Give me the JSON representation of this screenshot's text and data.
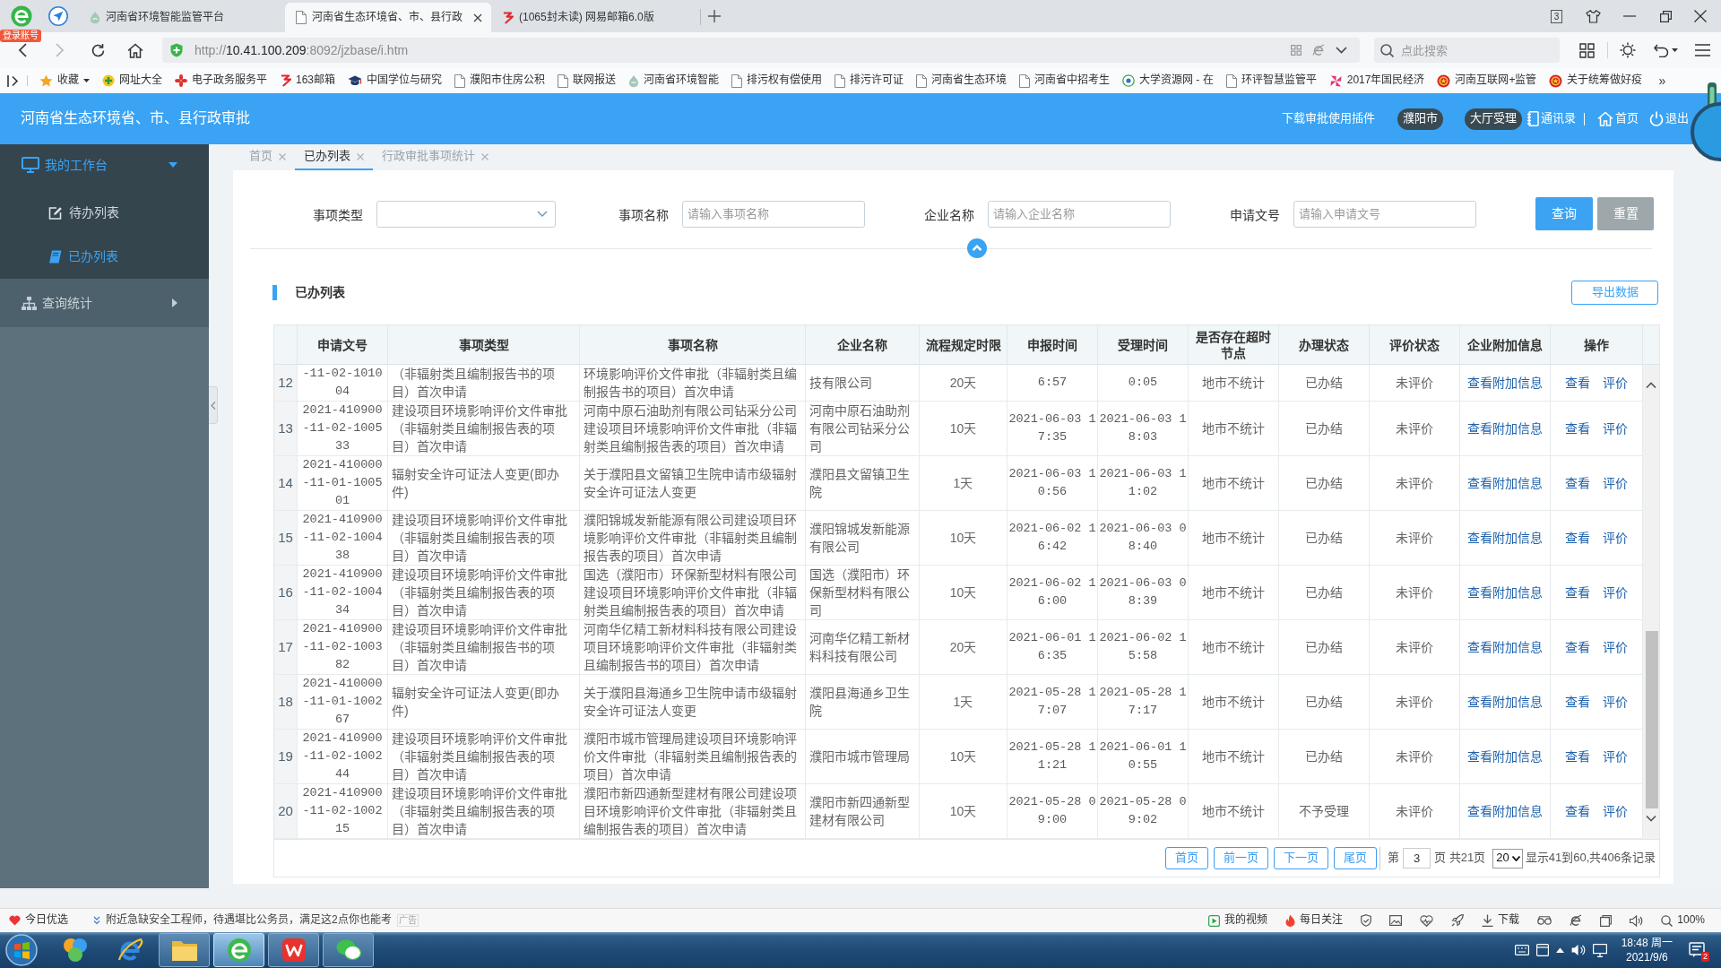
{
  "browser": {
    "login_badge": "登录账号",
    "tabs": [
      {
        "title": "河南省环境智能监管平台",
        "selected": false
      },
      {
        "title": "河南省生态环境省、市、县行政",
        "selected": true
      },
      {
        "title": "(1065封未读) 网易邮箱6.0版",
        "selected": false
      }
    ],
    "tab_count": "3",
    "url": {
      "scheme": "http://",
      "host": "10.41.100.209",
      "path": ":8092/jzbase/i.htm"
    },
    "search": {
      "placeholder": "点此搜索"
    },
    "bookmarks": [
      {
        "label": "收藏"
      },
      {
        "label": "网址大全"
      },
      {
        "label": "电子政务服务平"
      },
      {
        "label": "163邮箱"
      },
      {
        "label": "中国学位与研究"
      },
      {
        "label": "濮阳市住房公积"
      },
      {
        "label": "联网报送"
      },
      {
        "label": "河南省环境智能"
      },
      {
        "label": "排污权有偿使用"
      },
      {
        "label": "排污许可证"
      },
      {
        "label": "河南省生态环境"
      },
      {
        "label": "河南省中招考生"
      },
      {
        "label": "大学资源网 - 在"
      },
      {
        "label": "环评智慧监管平"
      },
      {
        "label": "2017年国民经济"
      },
      {
        "label": "河南互联网+监管"
      },
      {
        "label": "关于统筹做好疫"
      }
    ],
    "bookmarks_more": "»"
  },
  "header": {
    "title": "河南省生态环境省、市、县行政审批",
    "links": [
      {
        "label": "下载审批使用插件",
        "kind": "link"
      },
      {
        "label": "濮阳市",
        "kind": "pill"
      },
      {
        "label": "大厅受理",
        "kind": "pill"
      },
      {
        "label": "通讯录",
        "kind": "link"
      },
      {
        "label": "首页",
        "kind": "link"
      },
      {
        "label": "退出",
        "kind": "link"
      }
    ]
  },
  "sidebar": {
    "items": [
      {
        "label": "我的工作台",
        "expanded": true,
        "children": [
          {
            "label": "待办列表",
            "selected": false
          },
          {
            "label": "已办列表",
            "selected": true
          }
        ]
      },
      {
        "label": "查询统计",
        "expanded": false
      }
    ]
  },
  "page_tabs": [
    {
      "label": "首页",
      "selected": false
    },
    {
      "label": "已办列表",
      "selected": true
    },
    {
      "label": "行政审批事项统计",
      "selected": false
    }
  ],
  "filters": {
    "fields": [
      {
        "label": "事项类型",
        "kind": "select"
      },
      {
        "label": "事项名称",
        "kind": "input",
        "placeholder": "请输入事项名称"
      },
      {
        "label": "企业名称",
        "kind": "input",
        "placeholder": "请输入企业名称"
      },
      {
        "label": "申请文号",
        "kind": "input",
        "placeholder": "请输入申请文号"
      }
    ],
    "buttons": [
      {
        "label": "查询",
        "kind": "primary"
      },
      {
        "label": "重置",
        "kind": "secondary"
      }
    ]
  },
  "list": {
    "title": "已办列表",
    "export_button": "导出数据",
    "table": {
      "columns": [
        "申请文号",
        "事项类型",
        "事项名称",
        "企业名称",
        "流程规定时限",
        "申报时间",
        "受理时间",
        "是否存在超时节点",
        "办理状态",
        "评价状态",
        "企业附加信息",
        "操作"
      ],
      "rows": [
        {
          "no": "12",
          "application_no": "-11-02-101004",
          "item_type": "（非辐射类且编制报告书的项目）首次申请",
          "item_name": "环境影响评价文件审批（非辐射类且编制报告书的项目）首次申请",
          "company": "技有限公司",
          "time_limit": "20天",
          "submitted": "6:57",
          "accepted": "0:05",
          "overtime": "地市不统计",
          "status": "已办结",
          "rating": "未评价",
          "extra_info": "查看附加信息",
          "actions": [
            "查看",
            "评价"
          ]
        },
        {
          "no": "13",
          "application_no": "2021-410900-11-02-100533",
          "item_type": "建设项目环境影响评价文件审批（非辐射类且编制报告表的项目）首次申请",
          "item_name": "河南中原石油助剂有限公司钻采分公司建设项目环境影响评价文件审批（非辐射类且编制报告表的项目）首次申请",
          "company": "河南中原石油助剂有限公司钻采分公司",
          "time_limit": "10天",
          "submitted": "2021-06-03 17:35",
          "accepted": "2021-06-03 18:03",
          "overtime": "地市不统计",
          "status": "已办结",
          "rating": "未评价",
          "extra_info": "查看附加信息",
          "actions": [
            "查看",
            "评价"
          ]
        },
        {
          "no": "14",
          "application_no": "2021-410000-11-01-100501",
          "item_type": "辐射安全许可证法人变更(即办件)",
          "item_name": "关于濮阳县文留镇卫生院申请市级辐射安全许可证法人变更",
          "company": "濮阳县文留镇卫生院",
          "time_limit": "1天",
          "submitted": "2021-06-03 10:56",
          "accepted": "2021-06-03 11:02",
          "overtime": "地市不统计",
          "status": "已办结",
          "rating": "未评价",
          "extra_info": "查看附加信息",
          "actions": [
            "查看",
            "评价"
          ]
        },
        {
          "no": "15",
          "application_no": "2021-410900-11-02-100438",
          "item_type": "建设项目环境影响评价文件审批（非辐射类且编制报告表的项目）首次申请",
          "item_name": "濮阳锦城发新能源有限公司建设项目环境影响评价文件审批（非辐射类且编制报告表的项目）首次申请",
          "company": "濮阳锦城发新能源有限公司",
          "time_limit": "10天",
          "submitted": "2021-06-02 16:42",
          "accepted": "2021-06-03 08:40",
          "overtime": "地市不统计",
          "status": "已办结",
          "rating": "未评价",
          "extra_info": "查看附加信息",
          "actions": [
            "查看",
            "评价"
          ]
        },
        {
          "no": "16",
          "application_no": "2021-410900-11-02-100434",
          "item_type": "建设项目环境影响评价文件审批（非辐射类且编制报告表的项目）首次申请",
          "item_name": "国选（濮阳市）环保新型材料有限公司建设项目环境影响评价文件审批（非辐射类且编制报告表的项目）首次申请",
          "company": "国选（濮阳市）环保新型材料有限公司",
          "time_limit": "10天",
          "submitted": "2021-06-02 16:00",
          "accepted": "2021-06-03 08:39",
          "overtime": "地市不统计",
          "status": "已办结",
          "rating": "未评价",
          "extra_info": "查看附加信息",
          "actions": [
            "查看",
            "评价"
          ]
        },
        {
          "no": "17",
          "application_no": "2021-410900-11-02-100382",
          "item_type": "建设项目环境影响评价文件审批（非辐射类且编制报告书的项目）首次申请",
          "item_name": "河南华亿精工新材料科技有限公司建设项目环境影响评价文件审批（非辐射类且编制报告书的项目）首次申请",
          "company": "河南华亿精工新材料科技有限公司",
          "time_limit": "20天",
          "submitted": "2021-06-01 16:35",
          "accepted": "2021-06-02 15:58",
          "overtime": "地市不统计",
          "status": "已办结",
          "rating": "未评价",
          "extra_info": "查看附加信息",
          "actions": [
            "查看",
            "评价"
          ]
        },
        {
          "no": "18",
          "application_no": "2021-410000-11-01-100267",
          "item_type": "辐射安全许可证法人变更(即办件)",
          "item_name": "关于濮阳县海通乡卫生院申请市级辐射安全许可证法人变更",
          "company": "濮阳县海通乡卫生院",
          "time_limit": "1天",
          "submitted": "2021-05-28 17:07",
          "accepted": "2021-05-28 17:17",
          "overtime": "地市不统计",
          "status": "已办结",
          "rating": "未评价",
          "extra_info": "查看附加信息",
          "actions": [
            "查看",
            "评价"
          ]
        },
        {
          "no": "19",
          "application_no": "2021-410900-11-02-100244",
          "item_type": "建设项目环境影响评价文件审批（非辐射类且编制报告表的项目）首次申请",
          "item_name": "濮阳市城市管理局建设项目环境影响评价文件审批（非辐射类且编制报告表的项目）首次申请",
          "company": "濮阳市城市管理局",
          "time_limit": "10天",
          "submitted": "2021-05-28 11:21",
          "accepted": "2021-06-01 10:55",
          "overtime": "地市不统计",
          "status": "已办结",
          "rating": "未评价",
          "extra_info": "查看附加信息",
          "actions": [
            "查看",
            "评价"
          ]
        },
        {
          "no": "20",
          "application_no": "2021-410900-11-02-100215",
          "item_type": "建设项目环境影响评价文件审批（非辐射类且编制报告表的项目）首次申请",
          "item_name": "濮阳市新四通新型建材有限公司建设项目环境影响评价文件审批（非辐射类且编制报告表的项目）首次申请",
          "company": "濮阳市新四通新型建材有限公司",
          "time_limit": "10天",
          "submitted": "2021-05-28 09:00",
          "accepted": "2021-05-28 09:02",
          "overtime": "地市不统计",
          "status": "不予受理",
          "rating": "未评价",
          "extra_info": "查看附加信息",
          "actions": [
            "查看",
            "评价"
          ]
        }
      ]
    },
    "pagination": {
      "buttons": [
        "首页",
        "前一页",
        "下一页",
        "尾页"
      ],
      "page_prefix": "第",
      "page": "3",
      "page_suffix": "页 共21页",
      "page_size": "20",
      "summary": "显示41到60,共406条记录"
    }
  },
  "status_bar": {
    "today_pick": "今日优选",
    "ad_text": "附近急缺安全工程师，待遇堪比公务员，满足这2点你也能考",
    "ad_tag": "广告",
    "links": [
      "我的视频",
      "每日关注"
    ],
    "download": "下载",
    "zoom": "100%"
  },
  "taskbar": {
    "apps": [
      {
        "open": false,
        "selected": false
      },
      {
        "open": false,
        "selected": false
      },
      {
        "open": true,
        "selected": false
      },
      {
        "open": true,
        "selected": true
      },
      {
        "open": true,
        "selected": false
      },
      {
        "open": true,
        "selected": false
      }
    ],
    "time": "18:48 周一",
    "date": "2021/9/6",
    "notification_count": "2"
  }
}
